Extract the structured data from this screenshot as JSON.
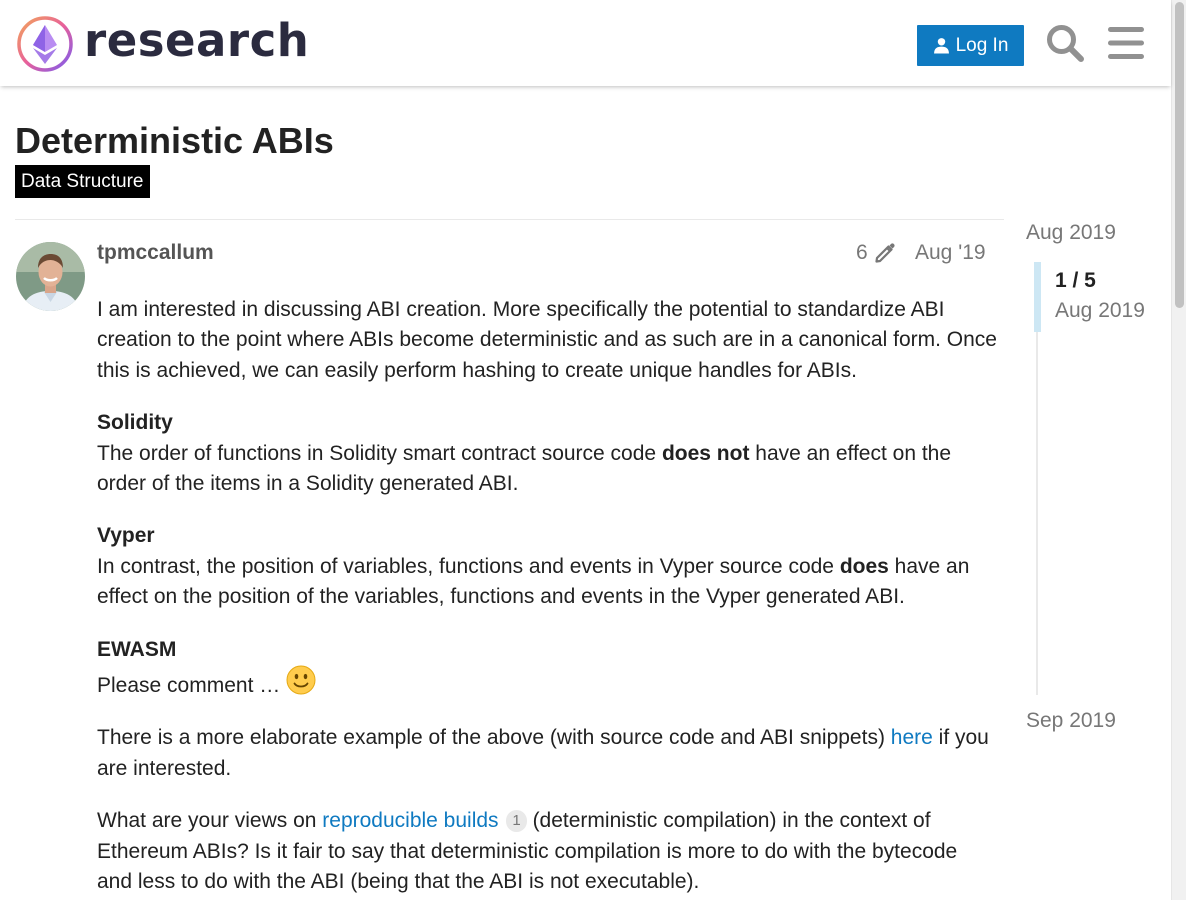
{
  "header": {
    "logo_text": "research",
    "login_label": "Log In",
    "icons": [
      "user-icon",
      "search-icon",
      "hamburger-menu-icon"
    ]
  },
  "topic": {
    "title": "Deterministic ABIs",
    "category": "Data Structure"
  },
  "post": {
    "username": "tpmccallum",
    "edit_count": "6",
    "date": "Aug '19",
    "p1": "I am interested in discussing ABI creation. More specifically the potential to standardize ABI creation to the point where ABIs become deterministic and as such are in a canonical form. Once this is achieved, we can easily perform hashing to create unique handles for ABIs.",
    "solidity_heading": "Solidity",
    "solidity_a": "The order of functions in Solidity smart contract source code ",
    "solidity_bold": "does not",
    "solidity_b": " have an effect on the order of the items in a Solidity generated ABI.",
    "vyper_heading": "Vyper",
    "vyper_a": "In contrast, the position of variables, functions and events in Vyper source code ",
    "vyper_bold": "does",
    "vyper_b": " have an effect on the position of the variables, functions and events in the Vyper generated ABI.",
    "ewasm_heading": "EWASM",
    "ewasm_text": "Please comment … ",
    "example_a": "There is a more elaborate example of the above (with source code and ABI snippets) ",
    "example_link": "here",
    "example_b": " if you are interested.",
    "views_a": "What are your views on ",
    "views_link": "reproducible builds",
    "views_link_clicks": "1",
    "views_b": " (deterministic compilation) in the context of Ethereum ABIs? Is it fair to say that deterministic compilation is more to do with the bytecode and less to do with the ABI (being that the ABI is not executable)."
  },
  "timeline": {
    "start_date": "Aug 2019",
    "position": "1 / 5",
    "position_date": "Aug 2019",
    "end_date": "Sep 2019"
  },
  "colors": {
    "accent": "#0f7ac1",
    "badge_bg": "#000000",
    "muted_text": "#777777",
    "timeline_handle": "#cde7f4"
  }
}
